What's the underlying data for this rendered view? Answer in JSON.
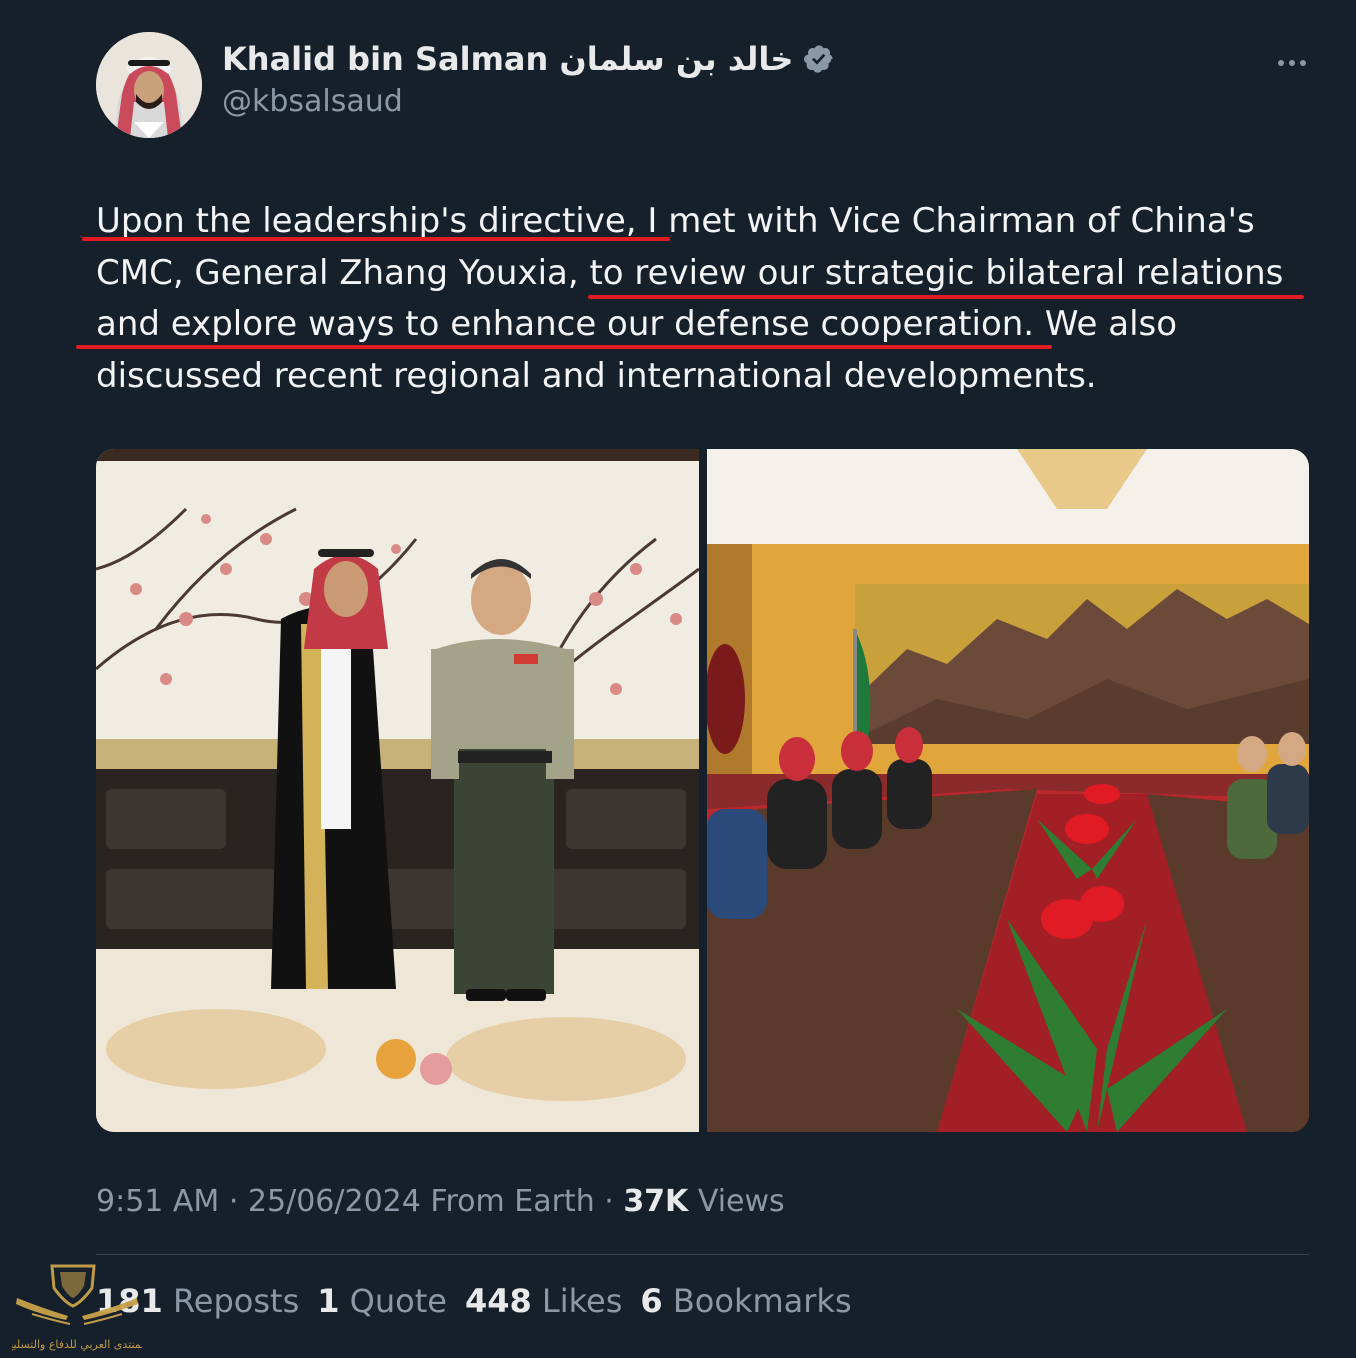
{
  "author": {
    "display_name": "Khalid bin Salman خالد بن سلمان",
    "handle": "@kbsalsaud",
    "verified": true
  },
  "tweet": {
    "text_lines": [
      "Upon the leadership's directive, I met with Vice Chairman of China's",
      "CMC, General Zhang Youxia, to review our strategic bilateral relations",
      "and explore ways to enhance our defense cooperation. We also",
      "discussed recent regional and international developments."
    ]
  },
  "media": {
    "photos": [
      {
        "description_icon": "photo-two-officials-standing"
      },
      {
        "description_icon": "photo-meeting-table"
      }
    ]
  },
  "meta": {
    "time": "9:51 AM",
    "separator": " · ",
    "date": "25/06/2024",
    "source": "From Earth",
    "views_count": "37K",
    "views_label": "Views"
  },
  "stats": {
    "reposts_count": "181",
    "reposts_label": "Reposts",
    "quotes_count": "1",
    "quotes_label": "Quote",
    "likes_count": "448",
    "likes_label": "Likes",
    "bookmarks_count": "6",
    "bookmarks_label": "Bookmarks"
  },
  "watermark": {
    "text": "المنتدى العربي للدفاع والتسليح"
  },
  "colors": {
    "background": "#15202b",
    "verified": "#8b98a5",
    "underline": "#e01b24",
    "secondary_text": "#8b98a5"
  }
}
